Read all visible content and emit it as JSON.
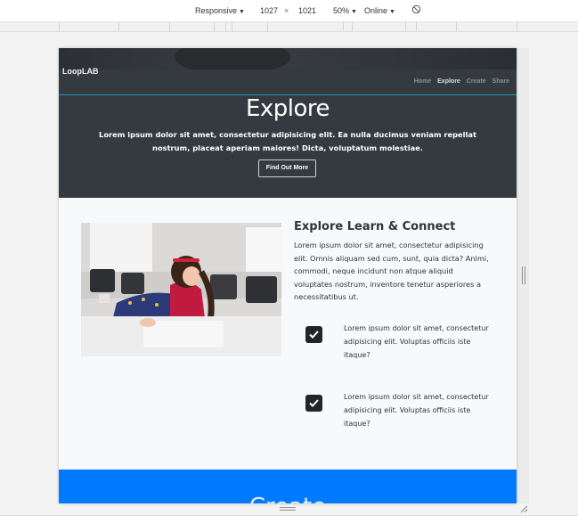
{
  "devtools": {
    "device": "Responsive",
    "width": "1027",
    "times": "×",
    "height": "1021",
    "zoom": "50%",
    "network": "Online"
  },
  "page": {
    "brand": "LoopLAB",
    "nav": [
      "Home",
      "Explore",
      "Create",
      "Share"
    ],
    "nav_active": "Explore",
    "hero": {
      "title": "Explore",
      "text": "Lorem ipsum dolor sit amet, consectetur adipisicing elit. Ea nulla ducimus veniam repellat nostrum, placeat aperiam maiores! Dicta, voluptatum molestiae.",
      "button": "Find Out More"
    },
    "section": {
      "title": "Explore Learn & Connect",
      "body": "Lorem ipsum dolor sit amet, consectetur adipisicing elit. Omnis aliquam sed cum, sunt, quia dicta? Animi, commodi, neque incidunt non atque aliquid voluptates nostrum, inventore tenetur asperiores a necessitatibus ut.",
      "features": [
        "Lorem ipsum dolor sit amet, consectetur adipisicing elit. Voluptas officiis iste itaque?",
        "Lorem ipsum dolor sit amet, consectetur adipisicing elit. Voluptas officiis iste itaque?"
      ]
    },
    "next_title": "Create",
    "colors": {
      "dark": "#343a40",
      "primary": "#007bff",
      "accent_line": "#1f8fbf"
    }
  }
}
